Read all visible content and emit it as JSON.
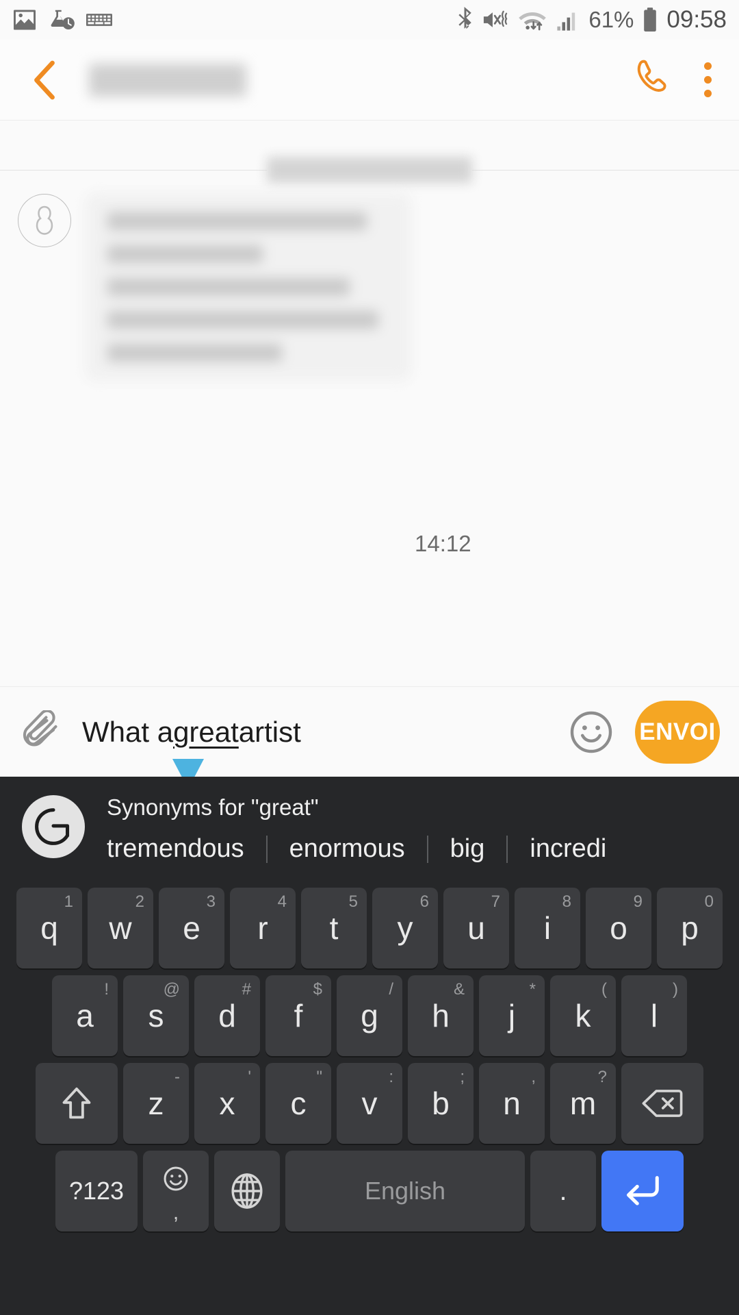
{
  "status_bar": {
    "left_icons": [
      "image-icon",
      "flask-clock-icon",
      "keyboard-icon"
    ],
    "right_icons": [
      "bluetooth-icon",
      "mute-vibrate-icon",
      "wifi-data-icon",
      "signal-bars-icon",
      "battery-icon"
    ],
    "battery_percent": "61%",
    "time": "09:58"
  },
  "app_bar": {
    "back_icon": "chevron-left-icon",
    "title": "",
    "call_icon": "phone-icon",
    "overflow_icon": "more-vertical-icon",
    "accent_color": "#ef8b22"
  },
  "conversation": {
    "date_divider_label": "",
    "avatar_icon": "person-avatar-icon",
    "incoming_message_text": "",
    "incoming_message_time": "14:12"
  },
  "compose": {
    "attach_icon": "paperclip-icon",
    "text_before": "What a ",
    "text_highlight": "great",
    "text_after": " artist",
    "emoji_icon": "smiley-icon",
    "send_label": "ENVOI",
    "send_color": "#f5a623",
    "cursor_handle_color": "#4db3e0"
  },
  "keyboard": {
    "background": "#262729",
    "suggestion_bar": {
      "logo": "grammarly-g-icon",
      "logo_letter": "G",
      "title": "Synonyms for \"great\"",
      "suggestions": [
        "tremendous",
        "enormous",
        "big",
        "incredi"
      ]
    },
    "row1": [
      {
        "main": "q",
        "sup": "1"
      },
      {
        "main": "w",
        "sup": "2"
      },
      {
        "main": "e",
        "sup": "3"
      },
      {
        "main": "r",
        "sup": "4"
      },
      {
        "main": "t",
        "sup": "5"
      },
      {
        "main": "y",
        "sup": "6"
      },
      {
        "main": "u",
        "sup": "7"
      },
      {
        "main": "i",
        "sup": "8"
      },
      {
        "main": "o",
        "sup": "9"
      },
      {
        "main": "p",
        "sup": "0"
      }
    ],
    "row2": [
      {
        "main": "a",
        "sup": "!"
      },
      {
        "main": "s",
        "sup": "@"
      },
      {
        "main": "d",
        "sup": "#"
      },
      {
        "main": "f",
        "sup": "$"
      },
      {
        "main": "g",
        "sup": "/"
      },
      {
        "main": "h",
        "sup": "&"
      },
      {
        "main": "j",
        "sup": "*"
      },
      {
        "main": "k",
        "sup": "("
      },
      {
        "main": "l",
        "sup": ")"
      }
    ],
    "row3": [
      {
        "main": "z",
        "sup": "-"
      },
      {
        "main": "x",
        "sup": "'"
      },
      {
        "main": "c",
        "sup": "\""
      },
      {
        "main": "v",
        "sup": ":"
      },
      {
        "main": "b",
        "sup": ";"
      },
      {
        "main": "n",
        "sup": ","
      },
      {
        "main": "m",
        "sup": "?"
      }
    ],
    "shift_icon": "shift-up-icon",
    "backspace_icon": "backspace-icon",
    "row4": {
      "symbols_label": "?123",
      "emoji_icon": "emoji-comma-icon",
      "emoji_sub": ",",
      "globe_icon": "globe-language-icon",
      "space_label": "English",
      "period_label": ".",
      "enter_icon": "enter-return-icon",
      "enter_color": "#4277f5"
    }
  }
}
